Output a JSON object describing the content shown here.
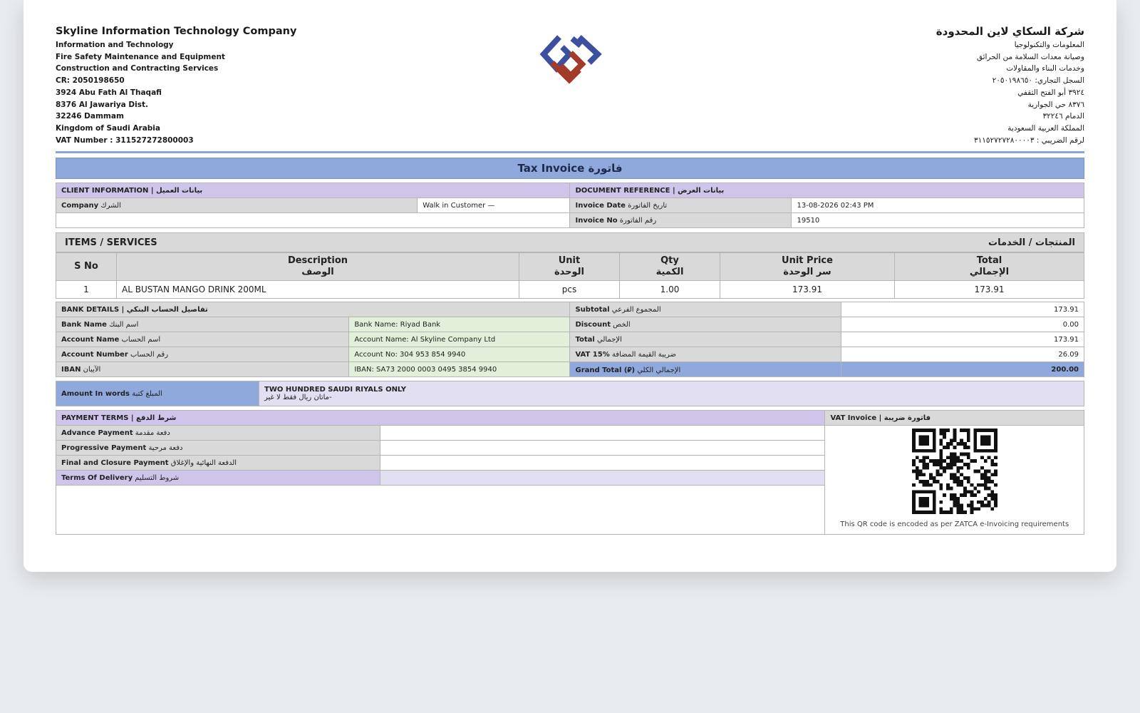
{
  "company_en": {
    "name": "Skyline Information Technology Company",
    "lines": [
      "Information and Technology",
      "Fire Safety Maintenance and Equipment",
      "Construction and Contracting Services",
      "CR: 2050198650",
      "3924 Abu Fath Al Thaqafi",
      "8376 Al Jawariya Dist.",
      "32246 Dammam",
      "Kingdom of Saudi Arabia",
      "VAT Number : 311527272800003"
    ]
  },
  "company_ar": {
    "name": "شركة السكاي لاين المحدودة",
    "lines": [
      "المعلومات والتكنولوجيا",
      "وصيانة معدات السلامة من الحرائق",
      "وخدمات البناء والمقاولات",
      "السجل التجاري: ٢٠٥٠١٩٨٦٥٠",
      "٣٩٢٤ أبو الفتح الثقفي",
      "٨٣٧٦ حي الجوارية",
      "الدمام ٣٢٢٤٦",
      "المملكة العربية السعودية",
      "لرقم الضريبي : ٣١١٥٢٧٢٧٢٨٠٠٠٠٣"
    ]
  },
  "colors": {
    "logo_blue": "#3d4f9f",
    "logo_red": "#a33b2b",
    "title_bg": "#8fa9dc",
    "section_lavender": "#cfc4ea",
    "bank_green": "#e2f0d9"
  },
  "title": "Tax Invoice فاتورة",
  "client": {
    "header": "CLIENT INFORMATION  |  بيانات العميل",
    "company_label": "Company",
    "company_label_ar": "الشرك",
    "company_value": "Walk in Customer —"
  },
  "docref": {
    "header": "DOCUMENT REFERENCE  |  بيانات العرض",
    "date_label": "Invoice Date",
    "date_label_ar": "تاريخ الفاتورة",
    "date_value": "13-08-2026 02:43 PM",
    "no_label": "Invoice No",
    "no_label_ar": "رقم الفاتورة",
    "no_value": "19510"
  },
  "items": {
    "header_en": "ITEMS / SERVICES",
    "header_ar": "المنتجات / الخدمات",
    "columns": [
      {
        "en": "S No",
        "ar": ""
      },
      {
        "en": "Description",
        "ar": "الوصف"
      },
      {
        "en": "Unit",
        "ar": "الوحدة"
      },
      {
        "en": "Qty",
        "ar": "الكمية"
      },
      {
        "en": "Unit Price",
        "ar": "سر الوحدة"
      },
      {
        "en": "Total",
        "ar": "الإجمالي"
      }
    ],
    "rows": [
      {
        "sno": "1",
        "desc": "AL BUSTAN MANGO DRINK 200ML",
        "unit": "pcs",
        "qty": "1.00",
        "price": "173.91",
        "total": "173.91"
      }
    ]
  },
  "bank": {
    "header": "BANK DETAILS  |  تفاصيل الحساب البنكي",
    "rows": [
      {
        "label": "Bank Name",
        "label_ar": "اسم البنك",
        "value": "Bank Name: Riyad Bank"
      },
      {
        "label": "Account Name",
        "label_ar": "اسم الحساب",
        "value": "Account Name: Al Skyline Company Ltd"
      },
      {
        "label": "Account Number",
        "label_ar": "رقم الحساب",
        "value": "Account No: 304 953 854 9940"
      },
      {
        "label": "IBAN",
        "label_ar": "الآيبان",
        "value": "IBAN: SA73 2000 0003 0495 3854 9940"
      }
    ]
  },
  "totals": [
    {
      "label": "Subtotal",
      "label_ar": "المجموع الفرعي",
      "value": "173.91"
    },
    {
      "label": "Discount",
      "label_ar": "الخص",
      "value": "0.00"
    },
    {
      "label": "Total",
      "label_ar": "الإجمالي",
      "value": "173.91"
    },
    {
      "label": "VAT 15%",
      "label_ar": "ضريبة القيمة المضافة",
      "value": "26.09"
    }
  ],
  "grand_total": {
    "label": "Grand Total (⃁)",
    "label_ar": "الإجمالي الكلي",
    "value": "200.00"
  },
  "words": {
    "label": "Amount In words",
    "label_ar": "المبلغ كتبة",
    "line1": "TWO HUNDRED SAUDI RIYALS ONLY",
    "line2": "ماتان ريال فقط لا غير-"
  },
  "payment": {
    "header": "PAYMENT TERMS  |  شرط الدفع",
    "rows": [
      {
        "label": "Advance Payment",
        "label_ar": "دفعة مقدمة"
      },
      {
        "label": "Progressive Payment",
        "label_ar": "دفعة مرحية"
      },
      {
        "label": "Final and Closure Payment",
        "label_ar": "الدفعة النهائية والإغلاق"
      },
      {
        "label": "Terms Of Delivery",
        "label_ar": "شروط التسليم"
      }
    ]
  },
  "vat": {
    "header": "VAT Invoice  |  فاتورة ضريبة",
    "qr_note": "This QR code is encoded as per ZATCA e-Invoicing requirements"
  }
}
